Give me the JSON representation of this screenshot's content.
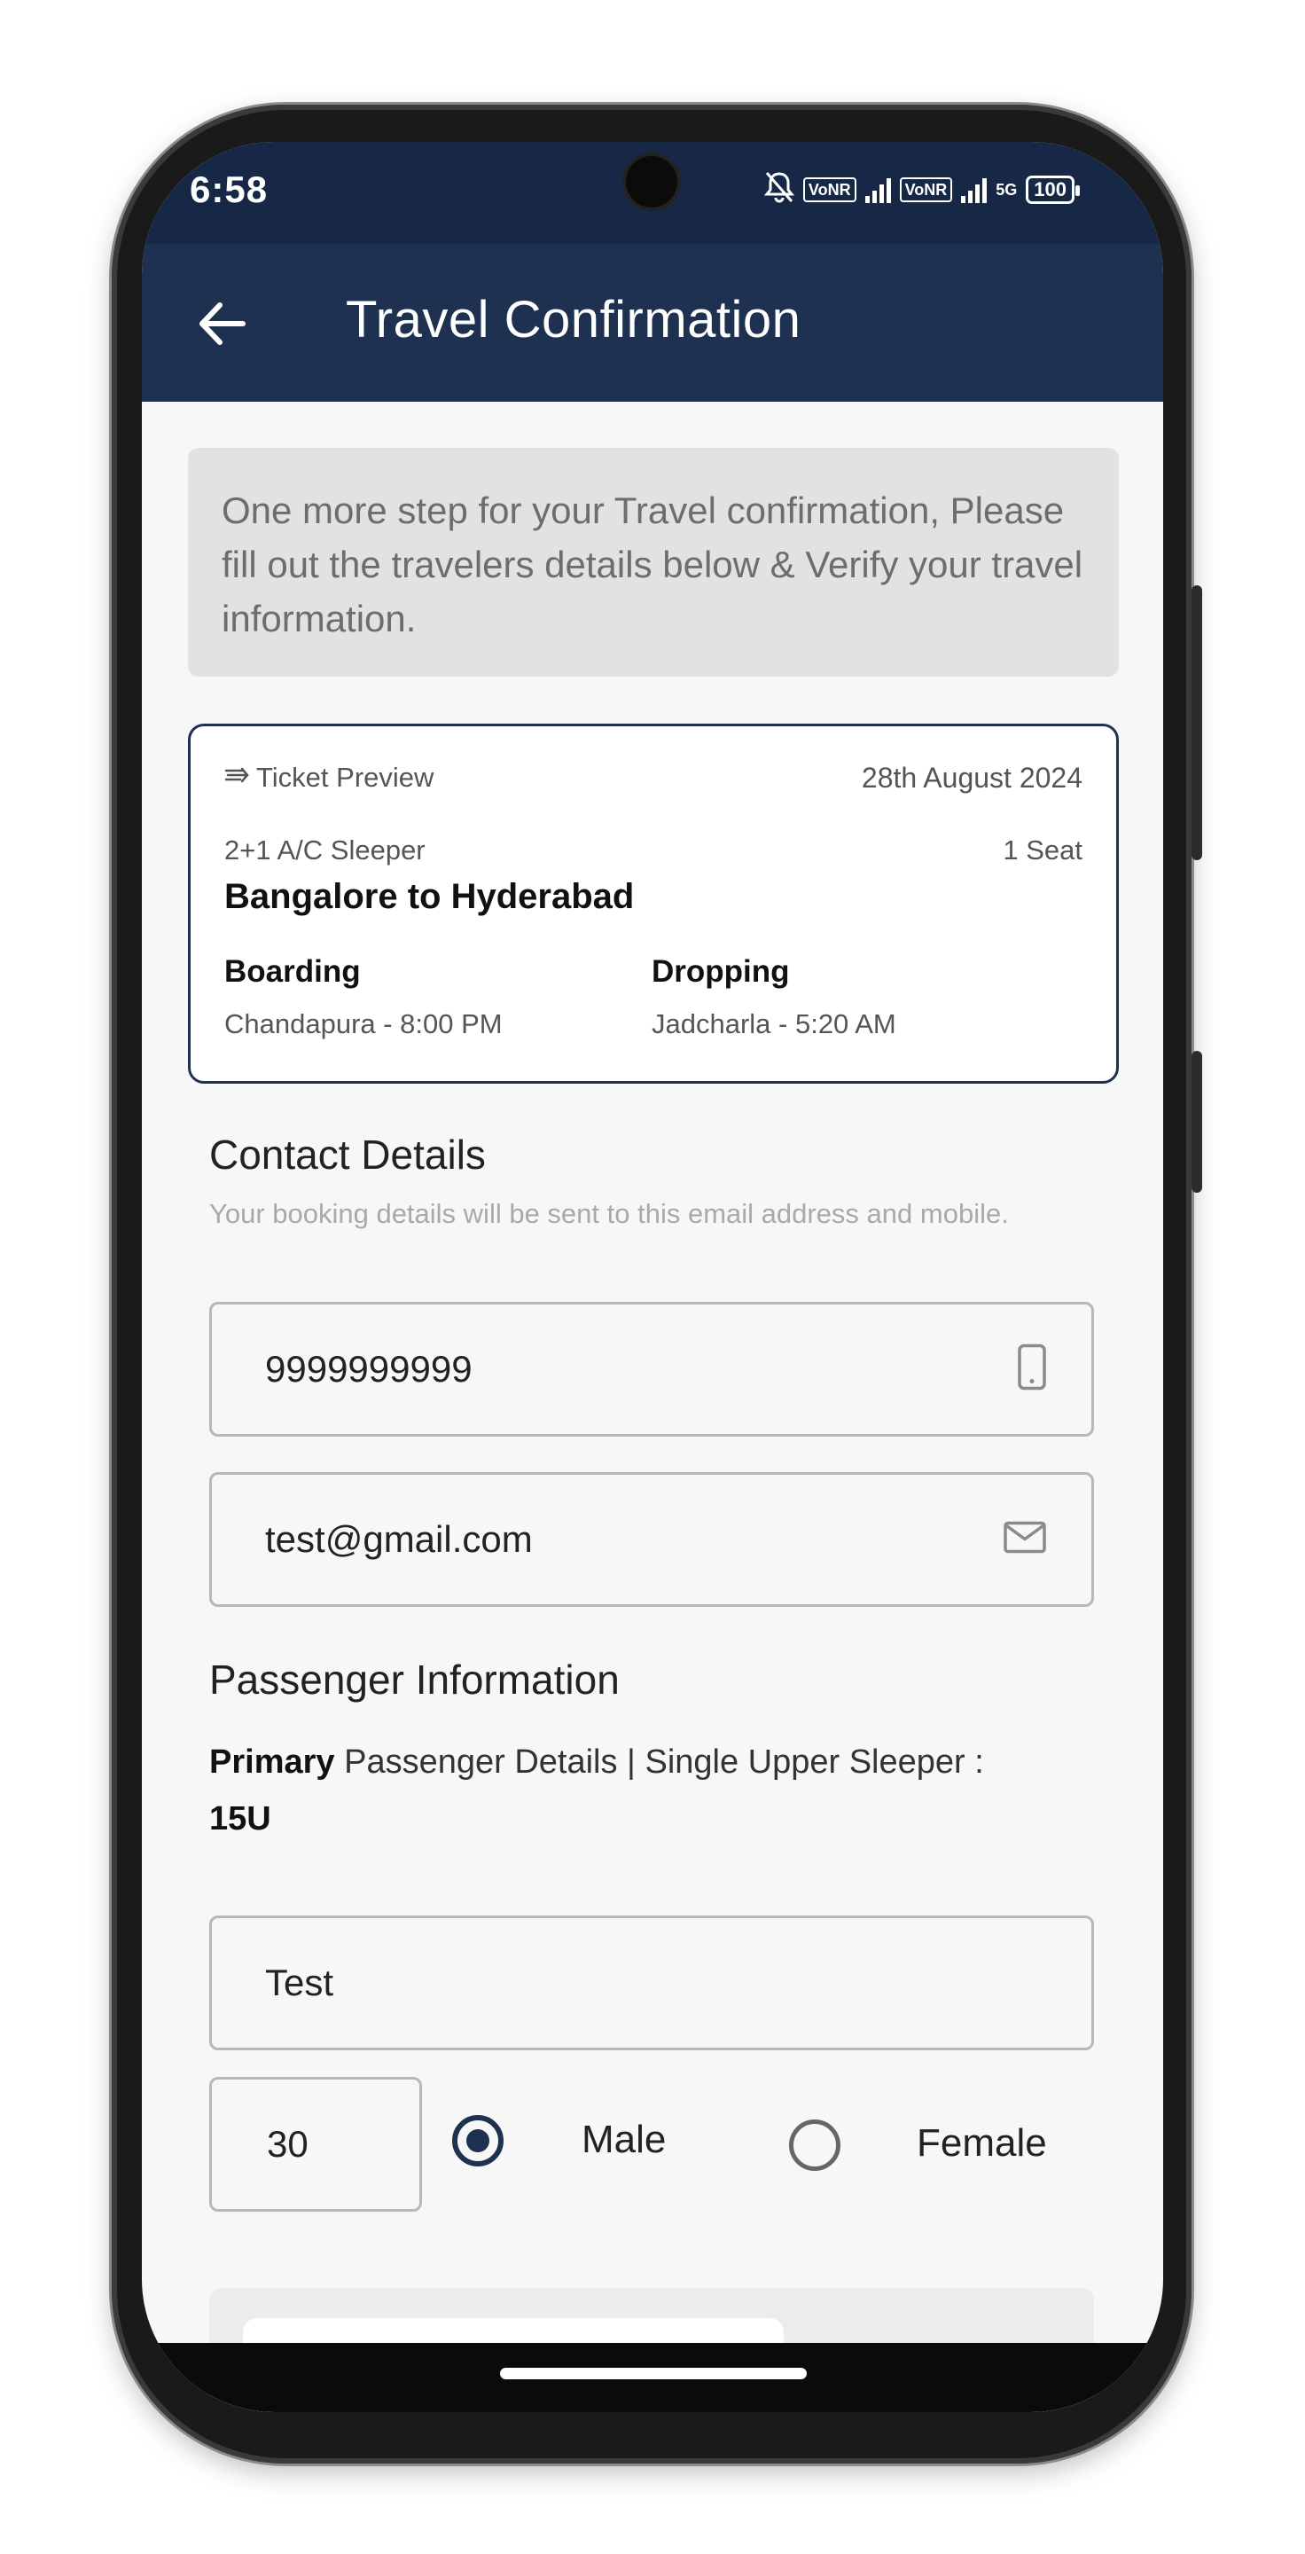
{
  "status_bar": {
    "time": "6:58",
    "network_1": "VoNR",
    "network_2": "VoNR",
    "network_type": "5G",
    "battery": "100"
  },
  "header": {
    "title": "Travel Confirmation"
  },
  "info_banner": {
    "text": "One more step for your Travel confirmation, Please fill out the travelers details below & Verify your travel information."
  },
  "ticket_preview": {
    "label": "Ticket Preview",
    "date": "28th August 2024",
    "bus_type": "2+1 A/C Sleeper",
    "seats": "1 Seat",
    "route": "Bangalore to Hyderabad",
    "boarding_label": "Boarding",
    "boarding_value": "Chandapura - 8:00 PM",
    "dropping_label": "Dropping",
    "dropping_value": "Jadcharla - 5:20 AM"
  },
  "contact_details": {
    "title": "Contact Details",
    "subtitle": "Your booking details will be sent to this email address and mobile.",
    "phone_value": "9999999999",
    "email_value": "test@gmail.com"
  },
  "passenger_information": {
    "title": "Passenger Information",
    "primary_label": "Primary",
    "details_text": " Passenger Details | Single Upper Sleeper : ",
    "seat_code": "15U",
    "name_value": "Test",
    "age_value": "30",
    "gender_options": [
      "Male",
      "Female"
    ],
    "selected_gender": "Male"
  },
  "colors": {
    "primary": "#1f3150",
    "status_bar": "#172846",
    "banner_bg": "#e2e2e2"
  },
  "icons": {
    "back": "arrow-left-icon",
    "ticket": "bus-ticket-icon",
    "phone": "smartphone-icon",
    "email": "mail-icon"
  }
}
